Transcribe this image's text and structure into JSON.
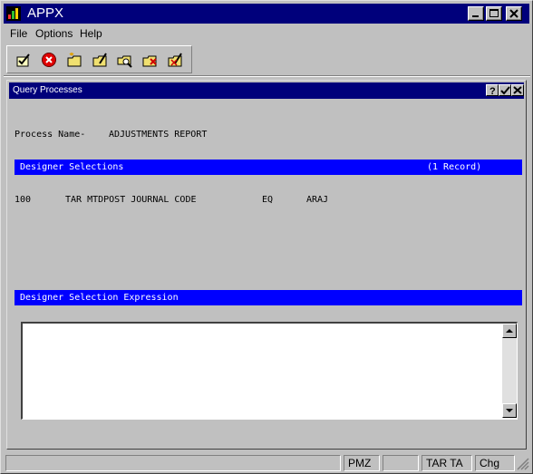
{
  "app": {
    "title": "APPX"
  },
  "menu": {
    "file": "File",
    "options": "Options",
    "help": "Help"
  },
  "toolbar": {
    "icons": [
      "check-doc-icon",
      "cancel-icon",
      "new-folder-icon",
      "edit-folder-icon",
      "search-folder-icon",
      "delete-folder-icon",
      "edit-delete-folder-icon"
    ]
  },
  "child": {
    "title": "Query Processes",
    "process_label": "Process Name-",
    "process_name": "ADJUSTMENTS REPORT",
    "selections_header": "Designer Selections",
    "selections_count": "(1 Record)",
    "selection_row": {
      "seq": "100",
      "field": "TAR MTDPOST JOURNAL CODE",
      "op": "EQ",
      "value": "ARAJ"
    },
    "expression_header": "Designer Selection Expression",
    "expression_value": ""
  },
  "status": {
    "p1": "",
    "p2": "PMZ",
    "p3": "",
    "p4": "TAR TA",
    "p5": "Chg"
  },
  "colors": {
    "titlebar": "#00007b",
    "section": "#0000ff",
    "face": "#c0c0c0"
  }
}
